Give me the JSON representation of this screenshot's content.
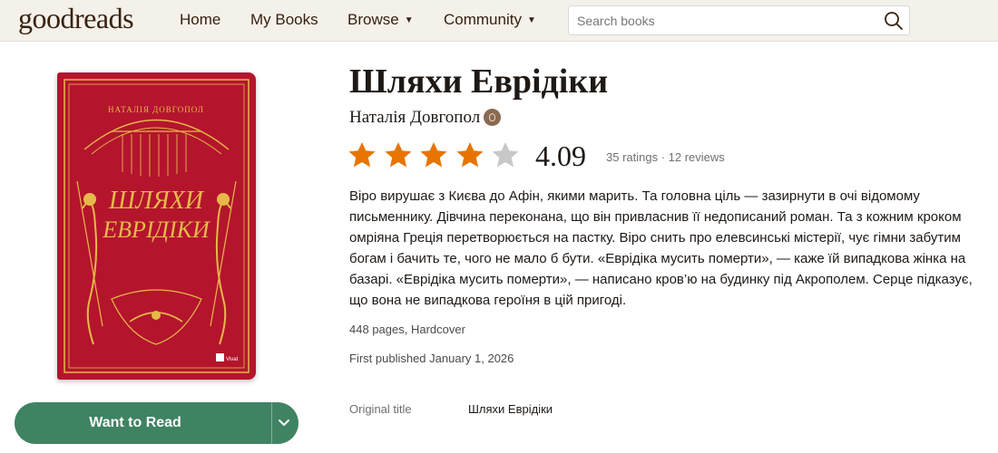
{
  "header": {
    "logo": "goodreads",
    "nav": [
      "Home",
      "My Books",
      "Browse",
      "Community"
    ],
    "search_placeholder": "Search books"
  },
  "book": {
    "title": "Шляхи Еврідіки",
    "author": "Наталія Довгопол",
    "rating": 4,
    "rating_value": "4.09",
    "rating_meta": "35 ratings · 12 reviews",
    "description": "Віро вирушає з Києва до Афін, якими марить. Та головна ціль — зазирнути в очі відомому письменнику. Дівчина переконана, що він привласнив її недописаний роман. Та з кожним кроком омріяна Греція перетворюється на пастку. Віро снить про елевсинські містерії, чує гімни забутим богам і бачить те, чого не мало б бути. «Еврідіка мусить померти», — каже їй випадкова жінка на базарі. «Еврідіка мусить померти», — написано кров’ю на будинку під Акрополем. Серце підказує, що вона не випадкова героїня в цій пригоді.",
    "pages_format": "448 pages, Hardcover",
    "first_published": "First published January 1, 2026",
    "original_title_label": "Original title",
    "original_title": "Шляхи Еврідіки",
    "want_to_read_label": "Want to Read"
  },
  "cover": {
    "author_text": "НАТАЛІЯ ДОВГОПОЛ",
    "title_line1": "ШЛЯХИ",
    "title_line2": "ЕВРІДІКИ",
    "publisher": "Vivat"
  },
  "colors": {
    "header_bg": "#f4f1ea",
    "star_filled": "#e87400",
    "star_empty": "#c8c8c8",
    "button_green": "#3f8363",
    "cover_red": "#b4152d",
    "cover_gold": "#e6b94a"
  }
}
